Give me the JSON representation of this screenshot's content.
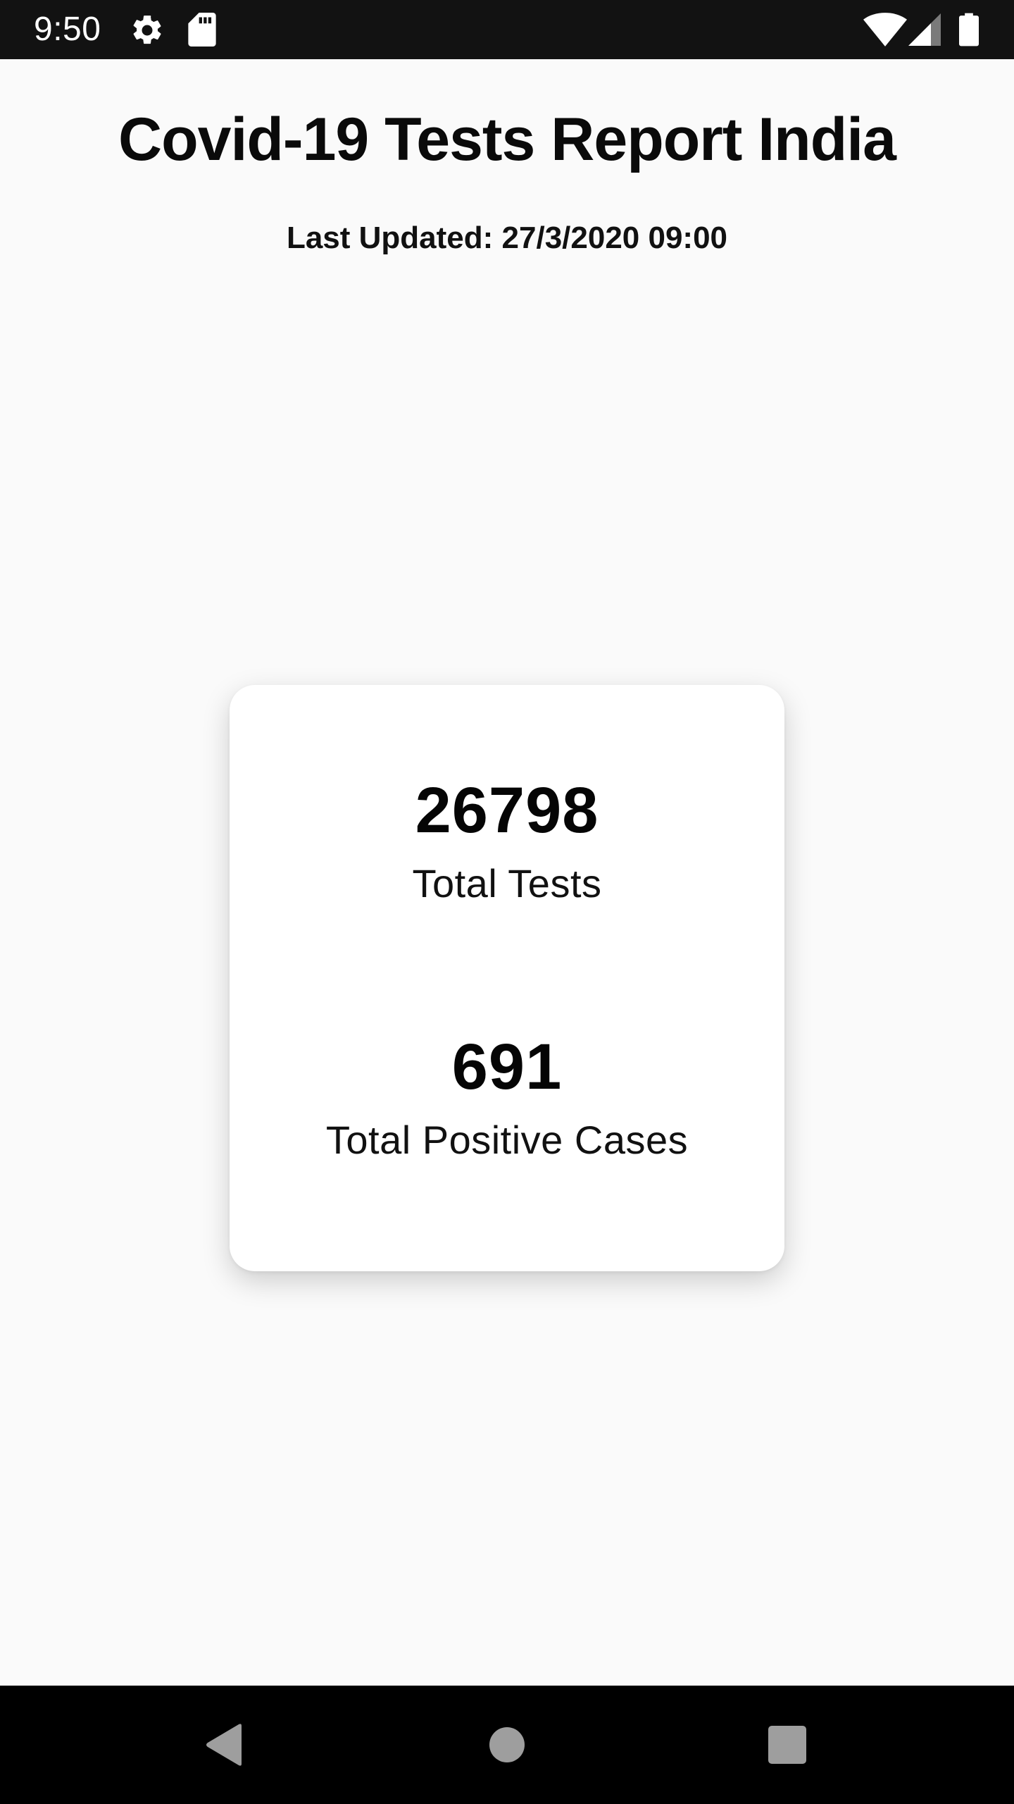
{
  "status_bar": {
    "time": "9:50",
    "icons": [
      "gear-icon",
      "sd-card-icon",
      "wifi-icon",
      "signal-icon",
      "battery-icon"
    ]
  },
  "header": {
    "title": "Covid-19 Tests Report India",
    "last_updated": "Last Updated: 27/3/2020 09:00"
  },
  "stats": {
    "total_tests": {
      "value": "26798",
      "label": "Total Tests"
    },
    "total_positive": {
      "value": "691",
      "label": "Total Positive Cases"
    }
  },
  "nav_bar": {
    "buttons": [
      "back-icon",
      "home-icon",
      "recents-icon"
    ]
  },
  "colors": {
    "background": "#fafafa",
    "status_bar": "#121212",
    "nav_bar": "#000000",
    "card": "#ffffff",
    "nav_icon": "#9e9e9e"
  }
}
